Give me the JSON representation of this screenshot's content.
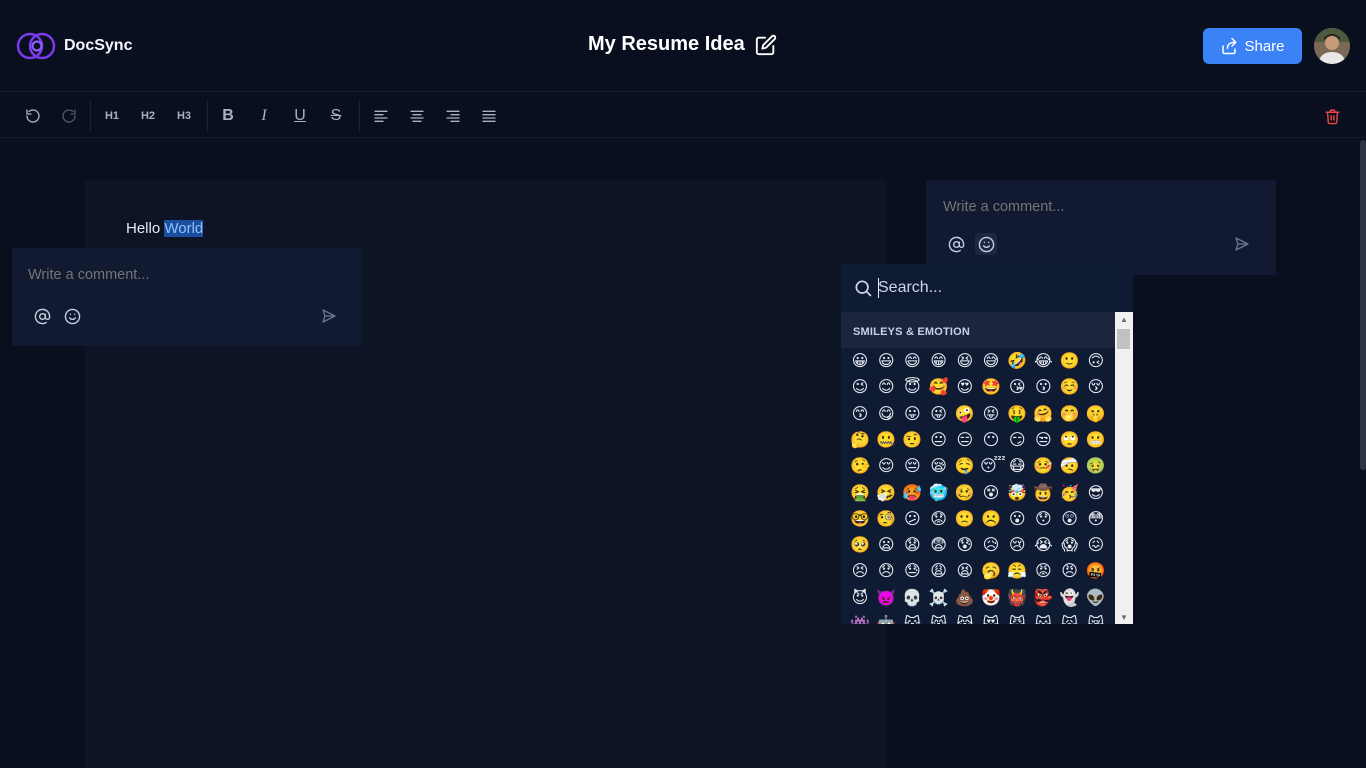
{
  "app": {
    "name": "DocSync"
  },
  "document": {
    "title": "My Resume Idea",
    "content_plain": "Hello ",
    "content_selected": "World"
  },
  "header": {
    "share_label": "Share"
  },
  "toolbar": {
    "headings": [
      "H1",
      "H2",
      "H3"
    ],
    "format_letters": [
      "B",
      "I",
      "U",
      "S"
    ]
  },
  "comments": [
    {
      "placeholder": "Write a comment..."
    },
    {
      "placeholder": "Write a comment..."
    }
  ],
  "emoji_picker": {
    "search_placeholder": "Search...",
    "category": "SMILEYS & EMOTION",
    "emojis": [
      "😀",
      "😃",
      "😄",
      "😁",
      "😆",
      "😅",
      "🤣",
      "😂",
      "🙂",
      "🙃",
      "😉",
      "😊",
      "😇",
      "🥰",
      "😍",
      "🤩",
      "😘",
      "😗",
      "☺️",
      "😚",
      "😙",
      "😋",
      "😛",
      "😜",
      "🤪",
      "😝",
      "🤑",
      "🤗",
      "🤭",
      "🤫",
      "🤔",
      "🤐",
      "🤨",
      "😐",
      "😑",
      "😶",
      "😏",
      "😒",
      "🙄",
      "😬",
      "🤥",
      "😌",
      "😔",
      "😪",
      "🤤",
      "😴",
      "😷",
      "🤒",
      "🤕",
      "🤢",
      "🤮",
      "🤧",
      "🥵",
      "🥶",
      "🥴",
      "😵",
      "🤯",
      "🤠",
      "🥳",
      "😎",
      "🤓",
      "🧐",
      "😕",
      "😟",
      "🙁",
      "☹️",
      "😮",
      "😯",
      "😲",
      "😳",
      "🥺",
      "😦",
      "😧",
      "😨",
      "😰",
      "😥",
      "😢",
      "😭",
      "😱",
      "😖",
      "😣",
      "😞",
      "😓",
      "😩",
      "😫",
      "🥱",
      "😤",
      "😡",
      "😠",
      "🤬",
      "😈",
      "👿",
      "💀",
      "☠️",
      "💩",
      "🤡",
      "👹",
      "👺",
      "👻",
      "👽",
      "👾",
      "🤖",
      "😺",
      "😸",
      "😹",
      "😻",
      "😼",
      "😽",
      "🙀",
      "😿"
    ]
  },
  "colors": {
    "accent": "#3b82f6",
    "danger": "#ef4444",
    "logo": "#7c3aed"
  }
}
